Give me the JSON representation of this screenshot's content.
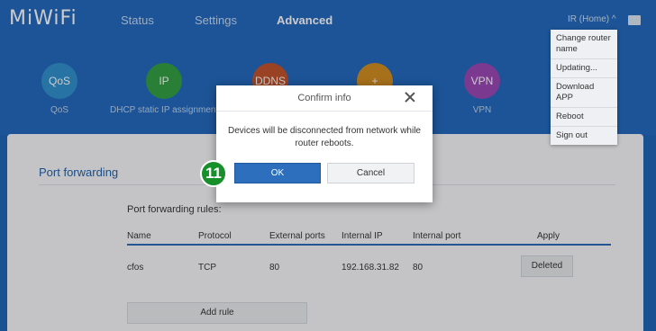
{
  "header": {
    "logo": "MiWiFi",
    "nav": [
      {
        "label": "Status"
      },
      {
        "label": "Settings"
      },
      {
        "label": "Advanced"
      }
    ],
    "user": "IR (Home) ^"
  },
  "features": [
    {
      "short": "QoS",
      "label": "QoS",
      "color": "#2d8fce"
    },
    {
      "short": "IP",
      "label": "DHCP static IP assignment",
      "color": "#2f9e3f"
    },
    {
      "short": "DDNS",
      "label": "",
      "color": "#c0502a"
    },
    {
      "short": "+",
      "label": "",
      "color": "#d18c1f"
    },
    {
      "short": "VPN",
      "label": "VPN",
      "color": "#9944b3"
    }
  ],
  "menu": {
    "items": [
      "Change router name",
      "Updating...",
      "Download APP",
      "Reboot",
      "Sign out"
    ]
  },
  "section": {
    "title": "Port forwarding",
    "rules_label": "Port forwarding rules:"
  },
  "table": {
    "headers": [
      "Name",
      "Protocol",
      "External ports",
      "Internal IP",
      "Internal port",
      "Apply"
    ],
    "rows": [
      {
        "name": "cfos",
        "protocol": "TCP",
        "external": "80",
        "ip": "192.168.31.82",
        "internal": "80",
        "action": "Deleted"
      }
    ]
  },
  "add_rule": "Add rule",
  "modal": {
    "title": "Confirm info",
    "message": "Devices will be disconnected from network while router reboots.",
    "ok": "OK",
    "cancel": "Cancel"
  },
  "step_badge": "11"
}
